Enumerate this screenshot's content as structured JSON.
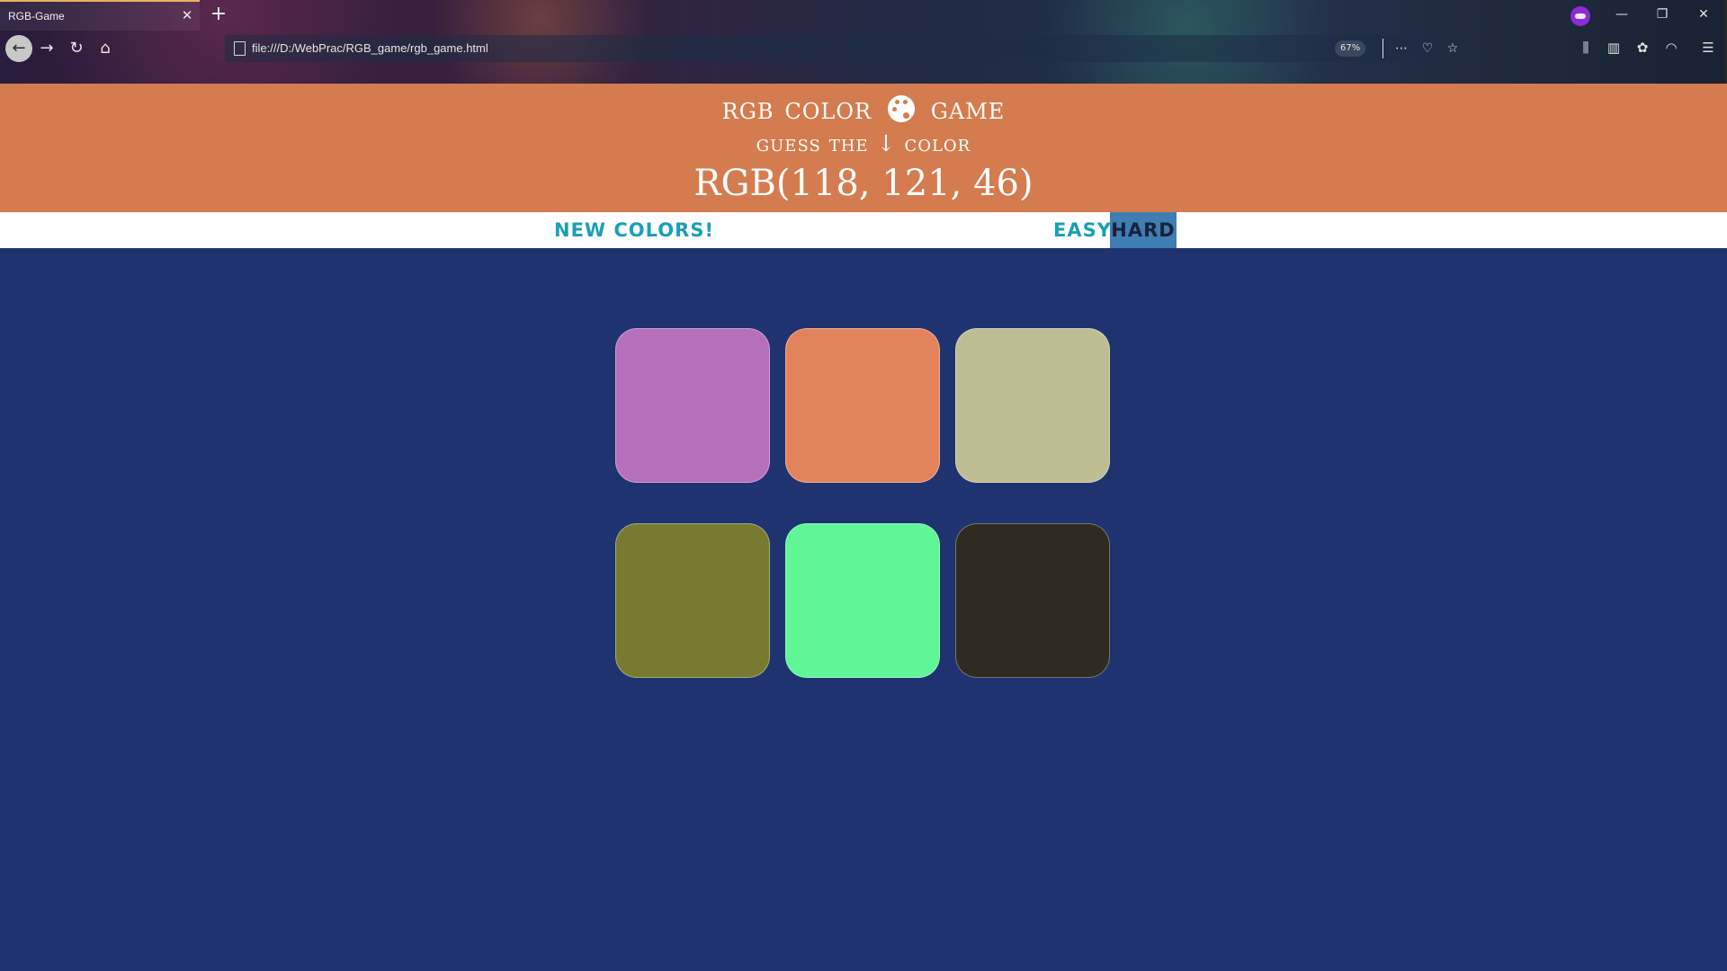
{
  "browser": {
    "tab_title": "RGB-Game",
    "tab_close": "✕",
    "new_tab": "+",
    "url": "file:///D:/WebPrac/RGB_game/rgb_game.html",
    "zoom": "67%",
    "window_controls": {
      "minimize": "—",
      "restore": "❐",
      "close": "✕"
    },
    "icons": [
      "back-arrow-icon",
      "forward-arrow-icon",
      "reload-icon",
      "home-icon",
      "page-icon",
      "more-icon",
      "pocket-icon",
      "bookmark-star-icon",
      "library-icon",
      "sidebar-icon",
      "extension-icon",
      "account-icon",
      "menu-icon",
      "private-mask-icon"
    ]
  },
  "game": {
    "title_part1": "RGB COLOR",
    "title_part2": "GAME",
    "subtitle_part1": "GUESS THE",
    "subtitle_arrow": "↓",
    "subtitle_part2": "COLOR",
    "target_rgb": "RGB(118, 121, 46)",
    "header_color": "#d47c4f",
    "background_color": "#1e3370",
    "controls": {
      "new_colors": "NEW COLORS!",
      "easy": "EASY",
      "hard": "HARD",
      "selected_mode": "HARD"
    },
    "squares": [
      {
        "color": "#b56fbb"
      },
      {
        "color": "#e3835c"
      },
      {
        "color": "#bebd93"
      },
      {
        "color": "#797a31"
      },
      {
        "color": "#60f597"
      },
      {
        "color": "#302b20"
      }
    ]
  }
}
